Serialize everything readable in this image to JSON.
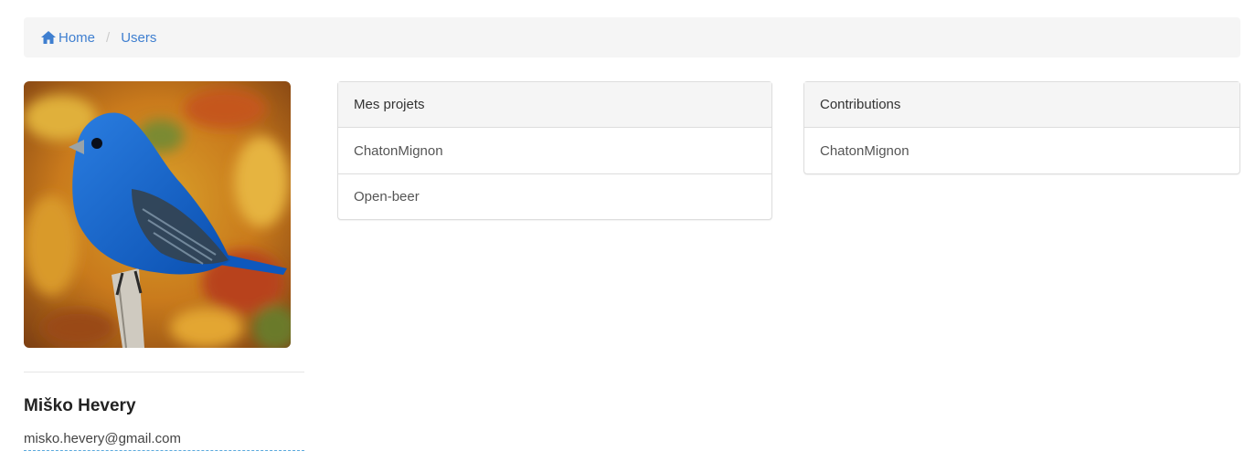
{
  "breadcrumb": {
    "items": [
      {
        "label": "Home",
        "icon": "home-icon"
      },
      {
        "label": "Users"
      }
    ],
    "separator": "/"
  },
  "profile": {
    "name": "Miško Hevery",
    "email": "misko.hevery@gmail.com",
    "avatar": "blue-bird-photo"
  },
  "projects": {
    "heading": "Mes projets",
    "items": [
      "ChatonMignon",
      "Open-beer"
    ]
  },
  "contributions": {
    "heading": "Contributions",
    "items": [
      "ChatonMignon"
    ]
  },
  "colors": {
    "link": "#3f7fd0",
    "breadcrumb_bg": "#f5f5f5",
    "panel_border": "#dddddd"
  }
}
